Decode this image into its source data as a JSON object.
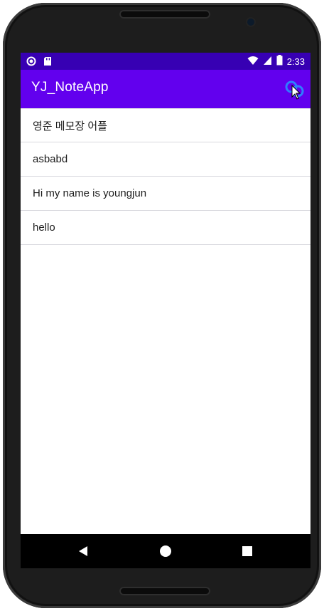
{
  "status_bar": {
    "time": "2:33",
    "left_icons": [
      "circle-notification-icon",
      "sd-card-icon"
    ],
    "right_icons": [
      "wifi-icon",
      "cellular-signal-icon",
      "battery-icon"
    ]
  },
  "app_bar": {
    "title": "YJ_NoteApp",
    "action_icon": "link-icon"
  },
  "notes": [
    {
      "label": "영준 메모장 어플"
    },
    {
      "label": "asbabd"
    },
    {
      "label": "Hi my name is youngjun"
    },
    {
      "label": "hello"
    }
  ],
  "nav_bar": {
    "buttons": [
      "back-icon",
      "home-icon",
      "recents-icon"
    ]
  },
  "colors": {
    "status_bar": "#3700b3",
    "app_bar": "#6200ee",
    "accent_icon": "#2f7dff"
  }
}
